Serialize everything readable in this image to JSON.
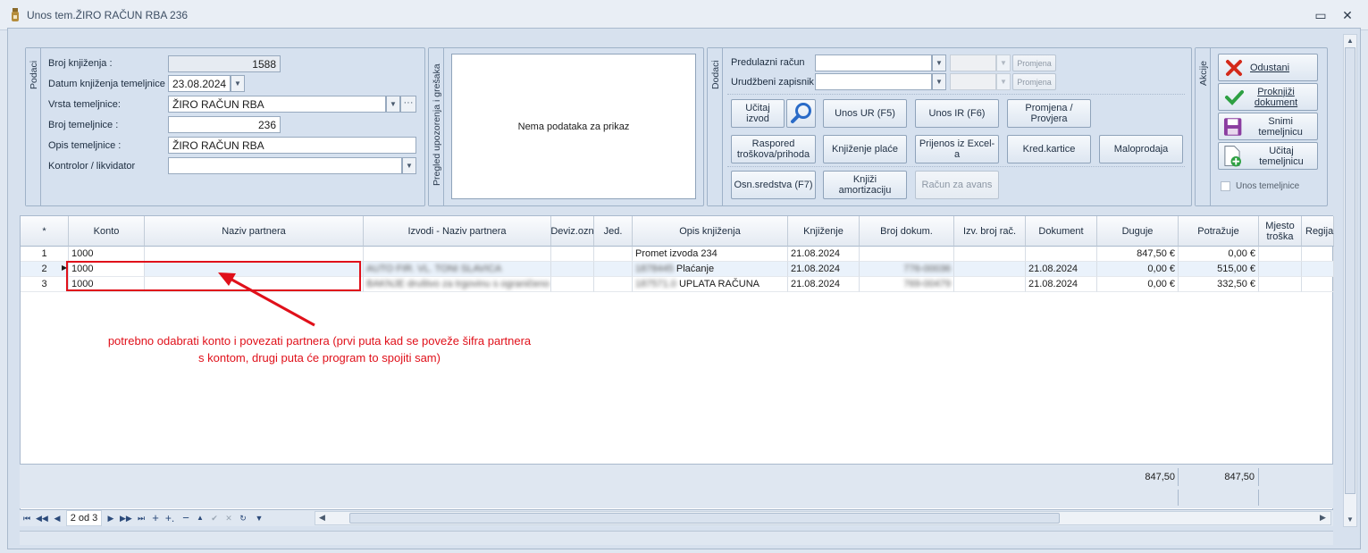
{
  "window": {
    "title": "Unos tem.ŽIRO RAČUN RBA 236",
    "minimize": "▭",
    "close": "✕"
  },
  "podaci": {
    "tab": "Podaci",
    "broj_knjizenja_label": "Broj knjiženja  :",
    "broj_knjizenja": "1588",
    "datum_label": "Datum knjiženja temeljnice",
    "datum": "23.08.2024",
    "vrsta_label": "Vrsta temeljnice:",
    "vrsta": "ŽIRO RAČUN RBA",
    "broj_temeljnice_label": "Broj temeljnice :",
    "broj_temeljnice": "236",
    "opis_label": "Opis temeljnice :",
    "opis": "ŽIRO RAČUN RBA",
    "kontrolor_label": "Kontrolor / likvidator",
    "kontrolor": ""
  },
  "pregled": {
    "tab": "Pregled upozorenja i grešaka",
    "empty": "Nema podataka za prikaz"
  },
  "dodaci": {
    "tab": "Dodaci",
    "predulazni_label": "Predulazni račun",
    "urudzbeni_label": "Urudžbeni zapisnik",
    "promjena": "Promjena",
    "buttons_row1": [
      "Učitaj izvod",
      "Unos UR (F5)",
      "Unos IR (F6)",
      "Promjena / Provjera"
    ],
    "buttons_row2": [
      "Raspored troškova/prihoda",
      "Knjiženje plaće",
      "Prijenos iz Excel-a",
      "Kred.kartice",
      "Maloprodaja"
    ],
    "buttons_row3": [
      "Osn.sredstva (F7)",
      "Knjiži amortizaciju",
      "Račun za avans"
    ]
  },
  "akcije": {
    "tab": "Akcije",
    "odustani": "Odustani",
    "proknjizi": "Proknjiži dokument",
    "snimi": "Snimi temeljnicu",
    "ucitaj": "Učitaj temeljnicu",
    "unos_temeljnice": "Unos temeljnice"
  },
  "grid": {
    "headers": [
      "*",
      "Konto",
      "Naziv partnera",
      "Izvodi - Naziv partnera",
      "Deviz.ozn",
      "Jed.",
      "Opis knjiženja",
      "Knjiženje",
      "Broj dokum.",
      "Izv. broj rač.",
      "Dokument",
      "Duguje",
      "Potražuje",
      "Mjesto troška",
      "Regija"
    ],
    "rows": [
      {
        "n": "1",
        "konto": "1000",
        "naziv": "",
        "izvodi": "",
        "opis": "Promet izvoda 234",
        "knjizenje": "21.08.2024",
        "broj": "",
        "dokument": "",
        "duguje": "847,50 €",
        "potrazuje": "0,00 €"
      },
      {
        "n": "2",
        "konto": "1000",
        "naziv": "",
        "izvodi": "AUTO FIR. VL. TONI SLAVICA",
        "opis_prefix": "1878445",
        "opis": "Plaćanje",
        "knjizenje": "21.08.2024",
        "broj": "776-00036",
        "dokument": "21.08.2024",
        "duguje": "0,00 €",
        "potrazuje": "515,00 €"
      },
      {
        "n": "3",
        "konto": "1000",
        "naziv": "",
        "izvodi": "BAKNJE društvo za trgovinu s ograničeno",
        "opis_prefix": "187571.0",
        "opis": "UPLATA RAČUNA",
        "knjizenje": "21.08.2024",
        "broj": "769-00479",
        "dokument": "21.08.2024",
        "duguje": "0,00 €",
        "potrazuje": "332,50 €"
      }
    ],
    "total_duguje": "847,50",
    "total_potrazuje": "847,50"
  },
  "navigator": {
    "record": "2 od 3"
  },
  "annotation": "potrebno odabrati konto i povezati partnera (prvi puta kad se poveže šifra partnera s kontom, drugi puta će program to spojiti sam)"
}
